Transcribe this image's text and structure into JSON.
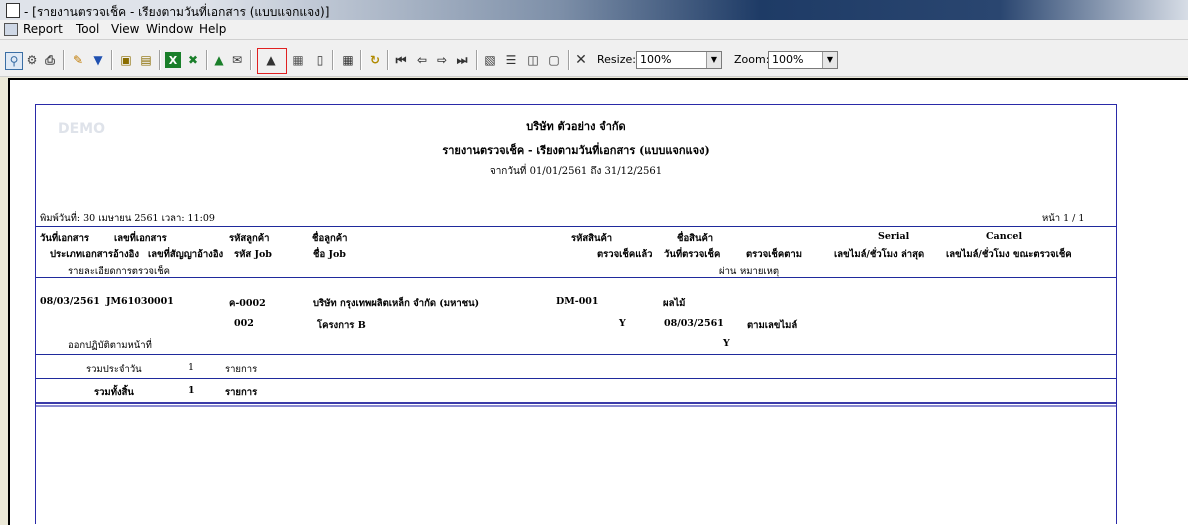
{
  "window": {
    "title": "- [รายงานตรวจเช็ค - เรียงตามวันที่เอกสาร (แบบแจกแจง)]"
  },
  "menu": {
    "items": [
      "Report",
      "Tool",
      "View",
      "Window",
      "Help"
    ]
  },
  "toolbar": {
    "resize_label": "Resize:",
    "resize_value": "100%",
    "zoom_label": "Zoom:",
    "zoom_value": "100%"
  },
  "report": {
    "watermark": "DEMO",
    "company": "บริษัท ตัวอย่าง จำกัด",
    "title": "รายงานตรวจเช็ค - เรียงตามวันที่เอกสาร (แบบแจกแจง)",
    "date_range": "จากวันที่ 01/01/2561 ถึง 31/12/2561",
    "print_info": "พิมพ์วันที่: 30 เมษายน 2561 เวลา: 11:09",
    "page": "หน้า 1 / 1",
    "headers": {
      "doc_date": "วันที่เอกสาร",
      "doc_no": "เลขที่เอกสาร",
      "cust_code": "รหัสลูกค้า",
      "cust_name": "ชื่อลูกค้า",
      "prod_code": "รหัสสินค้า",
      "prod_name": "ชื่อสินค้า",
      "serial": "Serial",
      "cancel": "Cancel",
      "ref_doc_type": "ประเภทเอกสารอ้างอิง",
      "ref_contract": "เลขที่สัญญาอ้างอิง",
      "job_code": "รหัส Job",
      "job_name": "ชื่อ Job",
      "checked": "ตรวจเช็คแล้ว",
      "check_date": "วันที่ตรวจเช็ค",
      "check_by": "ตรวจเช็คตาม",
      "serial_sub": "เลขไมล์/ชั่วโมง ล่าสุด",
      "cancel_sub": "เลขไมล์/ชั่วโมง ขณะตรวจเช็ค",
      "check_detail": "รายละเอียดการตรวจเช็ค",
      "pass": "ผ่าน",
      "remark": "หมายเหตุ"
    },
    "row": {
      "doc_date": "08/03/2561",
      "doc_no": "JM61030001",
      "cust_code": "ค-0002",
      "cust_name": "บริษัท กรุงเทพผลิตเหล็ก จำกัด (มหาชน)",
      "prod_code": "DM-001",
      "prod_name": "ผลไม้",
      "job_code": "002",
      "job_name": "โครงการ B",
      "checked": "Y",
      "check_date": "08/03/2561",
      "check_by": "ตามเลขไมล์",
      "detail": "ออกปฏิบัติตามหน้าที่",
      "pass": "Y"
    },
    "daily_total": {
      "label": "รวมประจำวัน",
      "count": "1",
      "unit": "รายการ"
    },
    "grand_total": {
      "label": "รวมทั้งสิ้น",
      "count": "1",
      "unit": "รายการ"
    }
  }
}
